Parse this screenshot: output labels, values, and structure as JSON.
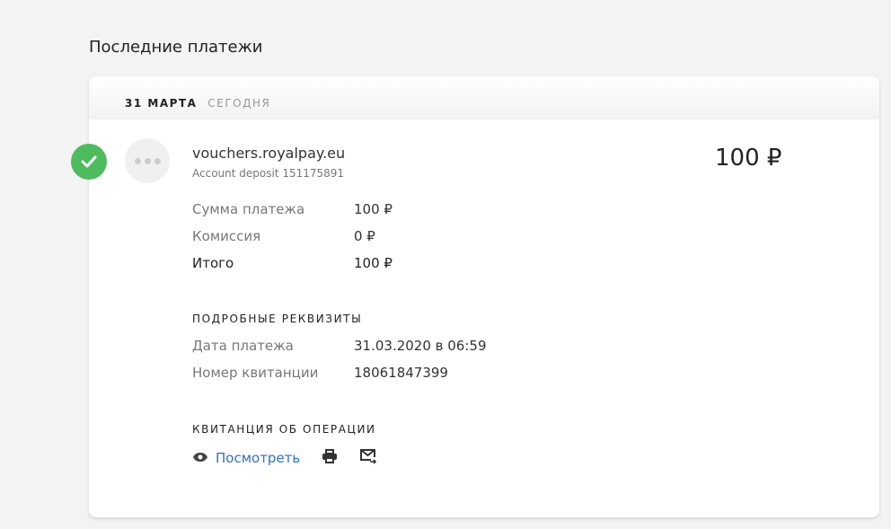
{
  "page_title": "Последние платежи",
  "group": {
    "date": "31 МАРТА",
    "relative": "СЕГОДНЯ"
  },
  "payment": {
    "merchant": "vouchers.royalpay.eu",
    "description": "Account deposit 151175891",
    "amount": "100 ₽",
    "status_color": "#4cbc5d",
    "summary": [
      {
        "label": "Сумма платежа",
        "value": "100 ₽"
      },
      {
        "label": "Комиссия",
        "value": "0 ₽"
      },
      {
        "label": "Итого",
        "value": "100 ₽"
      }
    ],
    "details_heading": "ПОДРОБНЫЕ РЕКВИЗИТЫ",
    "details": [
      {
        "label": "Дата платежа",
        "value": "31.03.2020 в 06:59"
      },
      {
        "label": "Номер квитанции",
        "value": "18061847399"
      }
    ],
    "receipt_heading": "КВИТАНЦИЯ ОБ ОПЕРАЦИИ",
    "view_label": "Посмотреть"
  }
}
